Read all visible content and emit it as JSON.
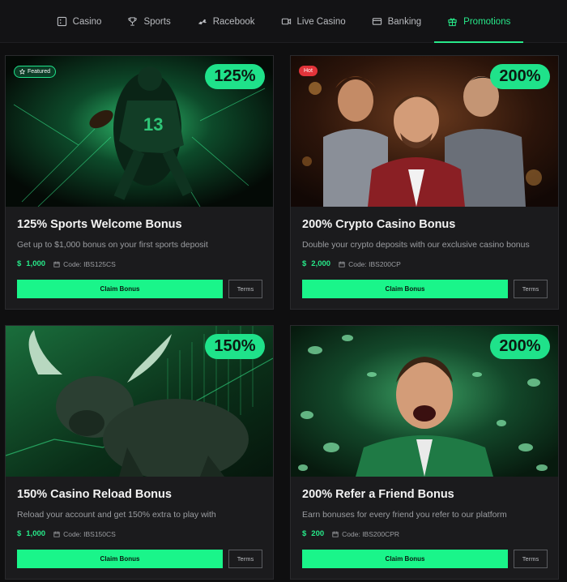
{
  "nav": {
    "tabs": [
      {
        "label": "Casino",
        "icon": "casino-icon"
      },
      {
        "label": "Sports",
        "icon": "trophy-icon"
      },
      {
        "label": "Racebook",
        "icon": "horse-icon"
      },
      {
        "label": "Live Casino",
        "icon": "video-icon"
      },
      {
        "label": "Banking",
        "icon": "card-icon"
      },
      {
        "label": "Promotions",
        "icon": "gift-icon",
        "active": true
      }
    ]
  },
  "colors": {
    "accent": "#1fe28a",
    "hot": "#e2343a",
    "background": "#0f0f10",
    "card": "#1b1b1d"
  },
  "promos": [
    {
      "percent": "125%",
      "tag": "Featured",
      "title": "125% Sports Welcome Bonus",
      "description": "Get up to $1,000 bonus on your first sports deposit",
      "currency": "$",
      "amount": "1,000",
      "code": "Code: IBS125CS",
      "claim_label": "Claim Bonus",
      "terms_label": "Terms",
      "image": "football-player-image"
    },
    {
      "percent": "200%",
      "tag": "Hot",
      "title": "200% Crypto Casino Bonus",
      "description": "Double your crypto deposits with our exclusive casino bonus",
      "currency": "$",
      "amount": "2,000",
      "code": "Code: IBS200CP",
      "claim_label": "Claim Bonus",
      "terms_label": "Terms",
      "image": "casino-men-image"
    },
    {
      "percent": "150%",
      "title": "150% Casino Reload Bonus",
      "description": "Reload your account and get 150% extra to play with",
      "currency": "$",
      "amount": "1,000",
      "code": "Code: IBS150CS",
      "claim_label": "Claim Bonus",
      "terms_label": "Terms",
      "image": "bull-image"
    },
    {
      "percent": "200%",
      "title": "200% Refer a Friend Bonus",
      "description": "Earn bonuses for every friend you refer to our platform",
      "currency": "$",
      "amount": "200",
      "code": "Code: IBS200CPR",
      "claim_label": "Claim Bonus",
      "terms_label": "Terms",
      "image": "excited-man-coins-image"
    }
  ]
}
